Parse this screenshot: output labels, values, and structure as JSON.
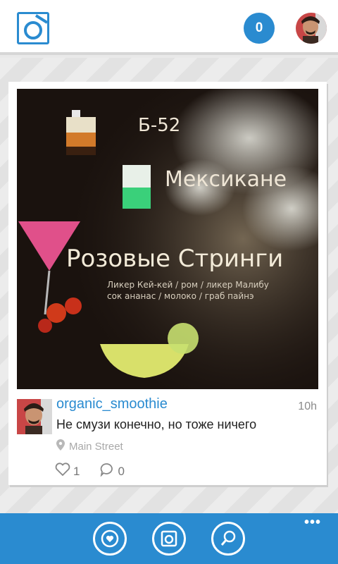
{
  "header": {
    "logo_icon": "camera-logo-icon",
    "notification_count": "0",
    "avatar_icon": "user-avatar-icon"
  },
  "photo": {
    "lines": [
      "Б-52",
      "Мексикане",
      "Розовые Стринги",
      "Ликер Кей-кей / ром / ликер Малибу",
      "сок ананас / молоко / граб пайнэ"
    ]
  },
  "post": {
    "username": "organic_smoothie",
    "time": "10h",
    "caption": "Не смузи конечно, но тоже ничего",
    "location": "Main Street",
    "likes": "1",
    "comments": "0"
  },
  "appbar": {
    "buttons": [
      "feed-heart-icon",
      "camera-icon",
      "search-icon"
    ],
    "more": "•••"
  },
  "colors": {
    "accent": "#2a8bd0",
    "header_bg": "#ffffff",
    "card_bg": "#ffffff"
  }
}
